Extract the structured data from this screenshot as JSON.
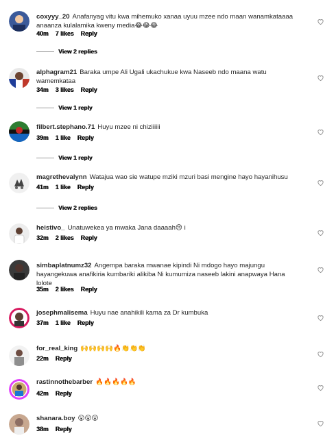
{
  "comments": [
    {
      "username": "coxyyy_20",
      "text": "Anafanyag vitu kwa mihemuko xanaa uyuu mzee ndo maan wanamkataaaa anaanza kulalamika kweny media😂😂😂",
      "time": "40m",
      "likes": "7 likes",
      "reply": "Reply",
      "view_replies": "View 2 replies",
      "avatar_color": "#3b5a9a"
    },
    {
      "username": "alphagram21",
      "text": "Baraka umpe Ali Ugali ukachukue kwa Naseeb ndo maana watu wamemkataa",
      "time": "34m",
      "likes": "3 likes",
      "reply": "Reply",
      "view_replies": "View 1 reply",
      "avatar_color": "#c0392b"
    },
    {
      "username": "filbert.stephano.71",
      "text": "Huyu mzee ni chiziiiiii",
      "time": "39m",
      "likes": "1 like",
      "reply": "Reply",
      "view_replies": "View 1 reply",
      "avatar_color": "#2e7d32"
    },
    {
      "username": "magrethevalynn",
      "text": "Watajua wao sie watupe mziki mzuri basi mengine hayo hayanihusu",
      "time": "41m",
      "likes": "1 like",
      "reply": "Reply",
      "view_replies": "View 2 replies",
      "avatar_color": "#555555"
    },
    {
      "username": "heistivo_",
      "text": "Unatuwekea ya mwaka Jana daaaah😢 i",
      "time": "32m",
      "likes": "2 likes",
      "reply": "Reply",
      "avatar_color": "#e6e6e6"
    },
    {
      "username": "simbaplatnumz32",
      "text": "Angempa baraka mwanae kipindi Ni mdogo hayo majungu hayangekuwa anafikiria kumbariki alikiba Ni kumumiza naseeb lakini anapwaya Hana lolote",
      "time": "35m",
      "likes": "2 likes",
      "reply": "Reply",
      "avatar_color": "#3a3a3a"
    },
    {
      "username": "josephmalisema",
      "text": "Huyu nae anahikili kama za Dr kumbuka",
      "time": "37m",
      "likes": "1 like",
      "reply": "Reply",
      "avatar_color": "#d81b60"
    },
    {
      "username": "for_real_king",
      "text": "🙌🙌🙌🙌🔥👏👏👏",
      "time": "22m",
      "reply": "Reply",
      "avatar_color": "#dddddd"
    },
    {
      "username": "rastinnothebarber",
      "text": "🔥🔥🔥🔥🔥",
      "time": "42m",
      "reply": "Reply",
      "avatar_color": "#e040fb"
    },
    {
      "username": "shanara.boy",
      "text": "😮😮😮",
      "time": "38m",
      "reply": "Reply",
      "avatar_color": "#c8a890"
    }
  ],
  "colors": {
    "text": "#262626",
    "meta": "#111111",
    "divider": "#9a9a9a"
  },
  "icons": {
    "like": "heart-outline-icon"
  }
}
